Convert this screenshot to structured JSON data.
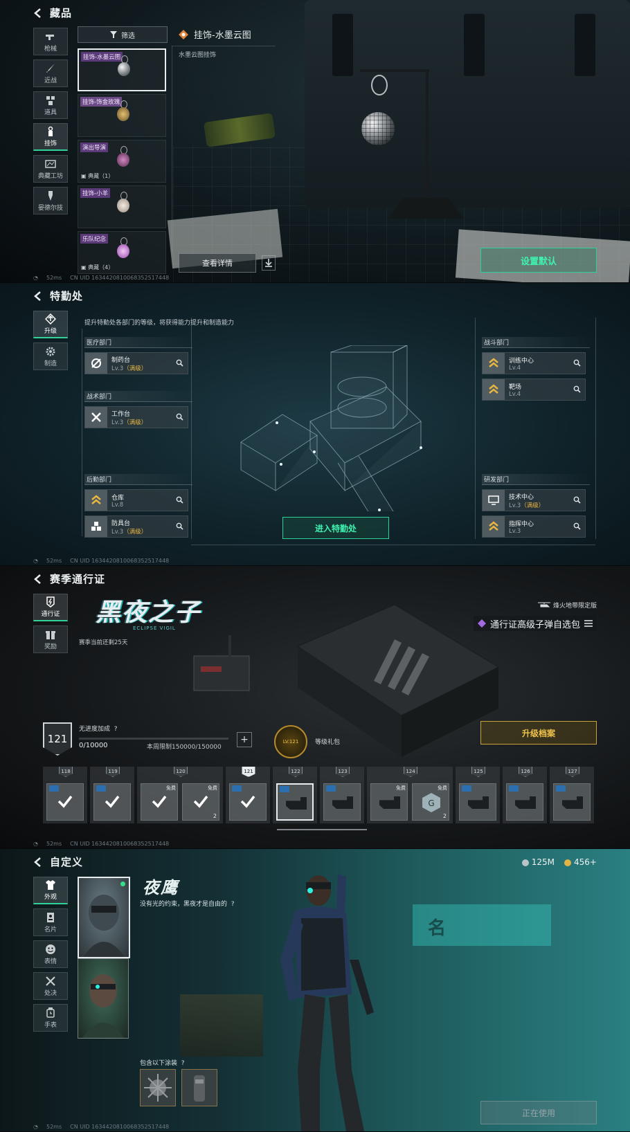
{
  "panel1": {
    "title": "藏品",
    "nav": [
      {
        "label": "枪械",
        "icon": "gun-icon"
      },
      {
        "label": "近战",
        "icon": "knife-icon"
      },
      {
        "label": "道具",
        "icon": "grenade-icon"
      },
      {
        "label": "挂饰",
        "icon": "charm-icon",
        "active": true
      },
      {
        "label": "典藏工坊",
        "icon": "workshop-icon"
      },
      {
        "label": "晏德尔技",
        "icon": "skill-icon"
      }
    ],
    "filter_label": "筛选",
    "items": [
      {
        "name": "挂饰-水墨云图",
        "extra": "",
        "color": "#c8ccd0",
        "selected": true
      },
      {
        "name": "挂饰-饰金玫瑰",
        "extra": "",
        "color": "#b89450"
      },
      {
        "name": "演出导演",
        "extra": "典藏（1）",
        "color": "#9a5a8a"
      },
      {
        "name": "挂饰-小羊",
        "extra": "",
        "color": "#d6cbc0"
      },
      {
        "name": "乐队纪念",
        "extra": "典藏（4）",
        "color": "#c070d0"
      }
    ],
    "detail_title": "挂饰-水墨云图",
    "detail_desc": "水墨云图挂饰",
    "view_details": "查看详情",
    "set_default": "设置默认",
    "status": {
      "ping": "52ms",
      "uid": "CN UID 1634420810068352517448"
    }
  },
  "panel2": {
    "title": "特勤处",
    "nav": [
      {
        "label": "升级",
        "icon": "upgrade-icon",
        "active": true
      },
      {
        "label": "制造",
        "icon": "gear-icon"
      }
    ],
    "desc": "提升特勤处各部门的等级，将获得能力提升和制造能力",
    "departments": {
      "medical": {
        "label": "医疗部门",
        "facilities": [
          {
            "name": "制药台",
            "level": "Lv.3",
            "maxed": "（满级）"
          }
        ]
      },
      "tactical": {
        "label": "战术部门",
        "facilities": [
          {
            "name": "工作台",
            "level": "Lv.3",
            "maxed": "（满级）"
          }
        ]
      },
      "logistics": {
        "label": "后勤部门",
        "facilities": [
          {
            "name": "仓库",
            "level": "Lv.8",
            "maxed": ""
          },
          {
            "name": "防具台",
            "level": "Lv.3",
            "maxed": "（满级）"
          }
        ]
      },
      "combat": {
        "label": "战斗部门",
        "facilities": [
          {
            "name": "训练中心",
            "level": "Lv.4",
            "maxed": ""
          },
          {
            "name": "靶场",
            "level": "Lv.4",
            "maxed": ""
          }
        ]
      },
      "research": {
        "label": "研发部门",
        "facilities": [
          {
            "name": "技术中心",
            "level": "Lv.3",
            "maxed": "（满级）"
          },
          {
            "name": "指挥中心",
            "level": "Lv.3",
            "maxed": ""
          }
        ]
      }
    },
    "enter_button": "进入特勤处",
    "status": {
      "ping": "52ms",
      "uid": "CN UID 1634420810068352517448"
    }
  },
  "panel3": {
    "title": "赛季通行证",
    "nav": [
      {
        "label": "通行证",
        "icon": "pass-icon",
        "active": true
      },
      {
        "label": "奖励",
        "icon": "gift-icon"
      }
    ],
    "season_name": "黑夜之子",
    "season_sub": "ECLIPSE VIGIL",
    "season_remaining": "赛季当前还剩25天",
    "limited_label": "烽火地带限定版",
    "pack_title": "通行证高级子弹自选包",
    "level": "121",
    "xp_label": "无进度加成",
    "xp_help": "?",
    "xp_value": "0/10000",
    "xp_progress": 0,
    "weekly_limit": "本周限制150000/150000",
    "gift_badge": "LV.121",
    "gift_label": "等级礼包",
    "upgrade_button": "升级档案",
    "tiers": [
      {
        "num": "118",
        "rewards": [
          {
            "state": "claimed",
            "tag": "",
            "count": ""
          }
        ]
      },
      {
        "num": "119",
        "rewards": [
          {
            "state": "claimed",
            "tag": "",
            "count": ""
          }
        ]
      },
      {
        "num": "120",
        "rewards": [
          {
            "state": "claimed",
            "tag": "免费",
            "count": ""
          },
          {
            "state": "claimed",
            "tag": "免费",
            "count": "2"
          }
        ]
      },
      {
        "num": "121",
        "current": true,
        "rewards": [
          {
            "state": "claimed",
            "tag": "",
            "count": ""
          }
        ]
      },
      {
        "num": "122",
        "rewards": [
          {
            "state": "locked",
            "tag": "",
            "count": "",
            "selected": true
          }
        ]
      },
      {
        "num": "123",
        "rewards": [
          {
            "state": "locked",
            "tag": "",
            "count": ""
          }
        ]
      },
      {
        "num": "124",
        "rewards": [
          {
            "state": "locked",
            "tag": "免费",
            "count": ""
          },
          {
            "state": "locked",
            "tag": "免费",
            "count": "2"
          }
        ]
      },
      {
        "num": "125",
        "rewards": [
          {
            "state": "locked",
            "tag": "",
            "count": ""
          }
        ]
      },
      {
        "num": "126",
        "rewards": [
          {
            "state": "locked",
            "tag": "",
            "count": ""
          }
        ]
      },
      {
        "num": "127",
        "rewards": [
          {
            "state": "locked",
            "tag": "",
            "count": ""
          }
        ]
      }
    ],
    "status": {
      "ping": "52ms",
      "uid": "CN UID 1634420810068352517448"
    }
  },
  "panel4": {
    "title": "自定义",
    "nav": [
      {
        "label": "外观",
        "icon": "outfit-icon",
        "active": true
      },
      {
        "label": "名片",
        "icon": "card-icon"
      },
      {
        "label": "表情",
        "icon": "emote-icon"
      },
      {
        "label": "处决",
        "icon": "execute-icon"
      },
      {
        "label": "手表",
        "icon": "watch-icon"
      }
    ],
    "currency": [
      {
        "value": "125M",
        "color": "#b9c4c8"
      },
      {
        "value": "456+",
        "color": "#e0b545"
      }
    ],
    "operator_name": "夜鹰",
    "operator_quote": "没有光的约束，黑夜才是自由的",
    "operator_help": "?",
    "wall_char": "名",
    "skins_label": "包含以下涂装",
    "skins_help": "?",
    "in_use": "正在使用",
    "status": {
      "ping": "52ms",
      "uid": "CN UID 1634420810068352517448"
    }
  },
  "colors": {
    "accent_green": "#2ed19a",
    "accent_gold": "#e9b640",
    "rarity_purple": "#5b3a7a"
  }
}
